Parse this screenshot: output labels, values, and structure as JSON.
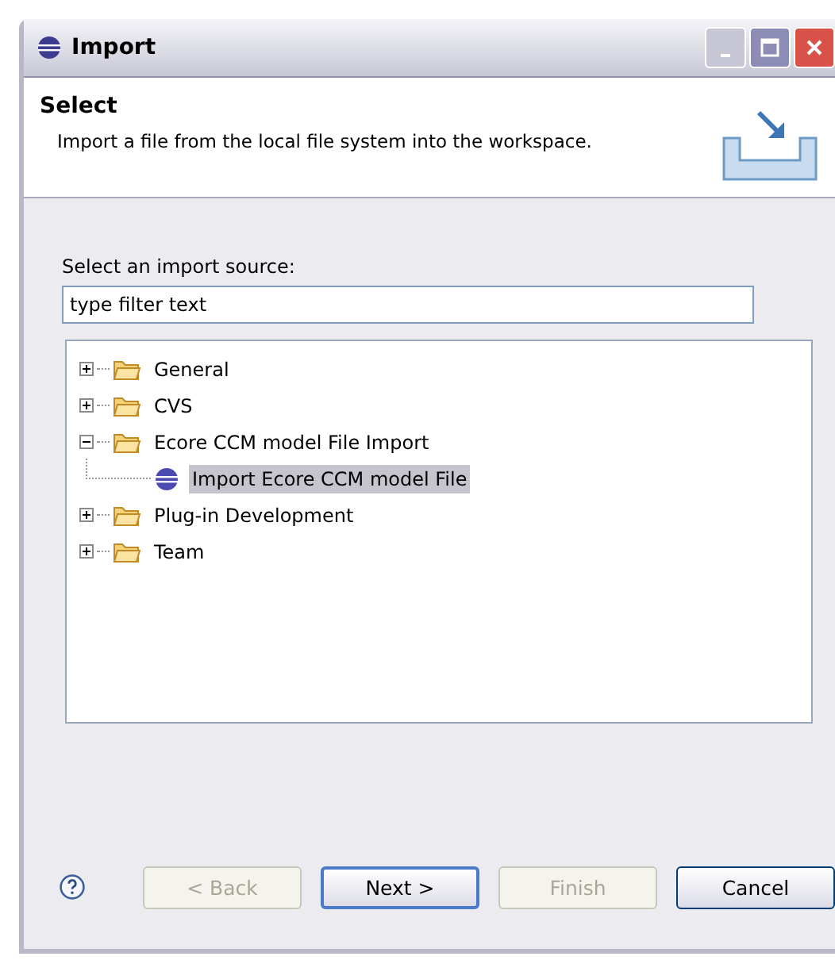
{
  "window": {
    "title": "Import"
  },
  "header": {
    "title": "Select",
    "description": "Import a file from the local file system into the workspace."
  },
  "source": {
    "label": "Select an import source:",
    "filter": {
      "value": "type filter text"
    }
  },
  "tree": [
    {
      "label": "General",
      "kind": "folder",
      "expanded": false,
      "selected": false
    },
    {
      "label": "CVS",
      "kind": "folder",
      "expanded": false,
      "selected": false
    },
    {
      "label": "Ecore CCM model File Import",
      "kind": "folder",
      "expanded": true,
      "selected": false,
      "children": [
        {
          "label": "Import Ecore CCM model File",
          "kind": "wizard",
          "selected": true
        }
      ]
    },
    {
      "label": "Plug-in Development",
      "kind": "folder",
      "expanded": false,
      "selected": false
    },
    {
      "label": "Team",
      "kind": "folder",
      "expanded": false,
      "selected": false
    }
  ],
  "buttons": [
    {
      "label": "< Back",
      "disabled": true,
      "default": false
    },
    {
      "label": "Next >",
      "disabled": false,
      "default": true
    },
    {
      "label": "Finish",
      "disabled": true,
      "default": false
    },
    {
      "label": "Cancel",
      "disabled": false,
      "default": false
    }
  ]
}
